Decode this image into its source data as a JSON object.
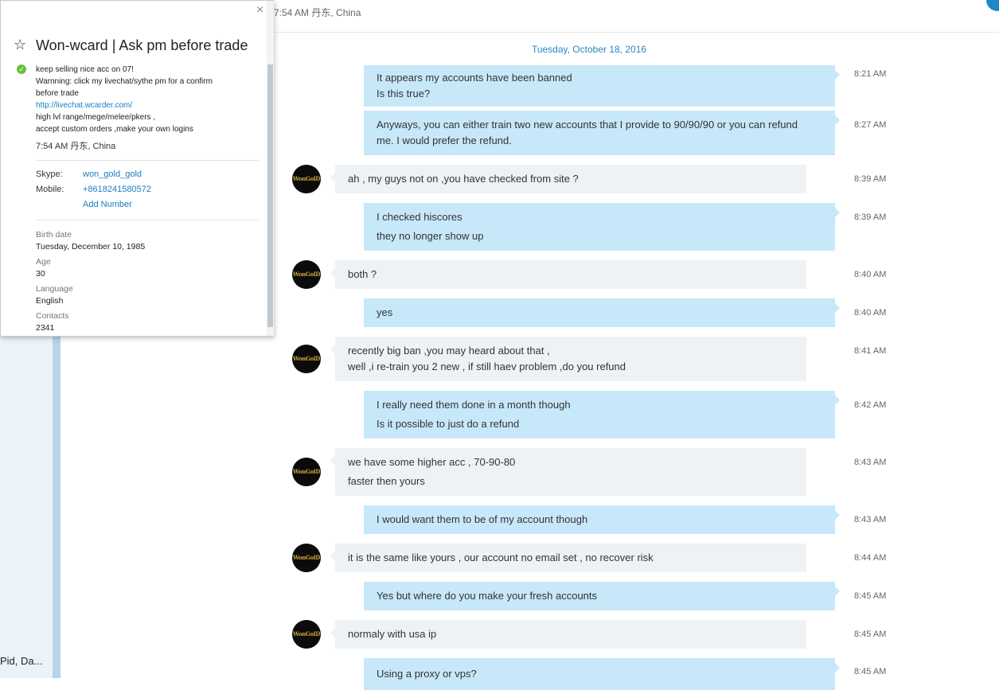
{
  "sidebar": {
    "bottom_text": "Pid, Da..."
  },
  "header": {
    "status": "7:54 AM 丹东, China"
  },
  "date_divider": "Tuesday, October 18, 2016",
  "avatar_text": "WonGolD",
  "messages": [
    {
      "dir": "out",
      "lines": [
        "It appears my accounts have been banned",
        "Is this true?"
      ],
      "time": "8:21 AM"
    },
    {
      "dir": "out",
      "lines": [
        "Anyways, you can either train two new accounts that I provide to 90/90/90 or you can refund",
        "me. I would prefer the refund."
      ],
      "time": "8:27 AM"
    },
    {
      "dir": "in",
      "lines": [
        "ah , my guys not on ,you have checked from site  ?"
      ],
      "time": "8:39 AM"
    },
    {
      "dir": "out",
      "lines": [
        "I checked hiscores",
        "they no longer show up"
      ],
      "time": "8:39 AM"
    },
    {
      "dir": "in",
      "lines": [
        "both ?"
      ],
      "time": "8:40 AM"
    },
    {
      "dir": "out",
      "lines": [
        "yes"
      ],
      "time": "8:40 AM"
    },
    {
      "dir": "in",
      "lines": [
        "recently big ban ,you may heard about that ,",
        "well ,i re-train you 2  new , if still haev problem ,do you refund"
      ],
      "time": "8:41 AM"
    },
    {
      "dir": "out",
      "lines": [
        "I really need them done in a month though",
        "Is it possible to just do a refund"
      ],
      "time": "8:42 AM"
    },
    {
      "dir": "in",
      "lines": [
        "we have some higher acc , 70-90-80",
        "faster then yours"
      ],
      "time": "8:43 AM"
    },
    {
      "dir": "out",
      "lines": [
        "I would want them to be of my account though"
      ],
      "time": "8:43 AM"
    },
    {
      "dir": "in",
      "lines": [
        "it is the same like yours , our account no email set , no recover risk"
      ],
      "time": "8:44 AM"
    },
    {
      "dir": "out",
      "lines": [
        "Yes but where do you make your fresh accounts"
      ],
      "time": "8:45 AM"
    },
    {
      "dir": "in",
      "lines": [
        "normaly with usa ip"
      ],
      "time": "8:45 AM"
    },
    {
      "dir": "out",
      "lines": [
        "Using a proxy or vps?"
      ],
      "time": "8:45 AM"
    }
  ],
  "profile": {
    "close_icon": "×",
    "star_icon": "☆",
    "name": "Won-wcard | Ask pm before trade",
    "mood_lines": [
      "keep selling nice acc on 07!",
      "Warnning: click my livechat/sythe pm for a confirm",
      "before trade",
      "http://livechat.wcarder.com/",
      "high lvl range/mege/melee/pkers ,",
      "accept custom orders ,make your own logins"
    ],
    "local_time": "7:54 AM 丹东, China",
    "skype_label": "Skype:",
    "skype_value": "won_gold_gold",
    "mobile_label": "Mobile:",
    "mobile_value": "+8618241580572",
    "add_number": "Add Number",
    "birth_label": "Birth date",
    "birth_value": "Tuesday, December 10, 1985",
    "age_label": "Age",
    "age_value": "30",
    "language_label": "Language",
    "language_value": "English",
    "contacts_label": "Contacts",
    "contacts_value": "2341"
  },
  "colors": {
    "outgoing_bubble": "#c7e8f9",
    "incoming_bubble": "#eff2f5",
    "link": "#1a7ec0",
    "presence_online": "#6ac13f"
  }
}
